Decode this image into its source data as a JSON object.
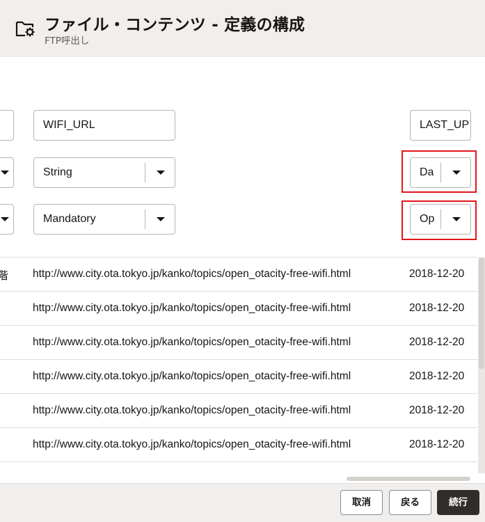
{
  "header": {
    "title": "ファイル・コンテンツ - 定義の構成",
    "subtitle": "FTP呼出し",
    "icon": "folder-gear-icon"
  },
  "columns": {
    "middle": {
      "name_value": "WIFI_URL",
      "type_value": "String",
      "requirement_value": "Mandatory"
    },
    "right": {
      "name_value": "LAST_UP",
      "type_value": "Da",
      "requirement_value": "Op"
    }
  },
  "rows": [
    {
      "left_fragment": "階",
      "url": "http://www.city.ota.tokyo.jp/kanko/topics/open_otacity-free-wifi.html",
      "date": "2018-12-20"
    },
    {
      "left_fragment": "",
      "url": "http://www.city.ota.tokyo.jp/kanko/topics/open_otacity-free-wifi.html",
      "date": "2018-12-20"
    },
    {
      "left_fragment": "",
      "url": "http://www.city.ota.tokyo.jp/kanko/topics/open_otacity-free-wifi.html",
      "date": "2018-12-20"
    },
    {
      "left_fragment": "",
      "url": "http://www.city.ota.tokyo.jp/kanko/topics/open_otacity-free-wifi.html",
      "date": "2018-12-20"
    },
    {
      "left_fragment": "",
      "url": "http://www.city.ota.tokyo.jp/kanko/topics/open_otacity-free-wifi.html",
      "date": "2018-12-20"
    },
    {
      "left_fragment": "",
      "url": "http://www.city.ota.tokyo.jp/kanko/topics/open_otacity-free-wifi.html",
      "date": "2018-12-20"
    }
  ],
  "footer": {
    "cancel_label": "取消",
    "back_label": "戻る",
    "continue_label": "続行"
  },
  "colors": {
    "highlight": "#e0171c",
    "primary_button": "#312d2a",
    "header_background": "#f1efed"
  }
}
